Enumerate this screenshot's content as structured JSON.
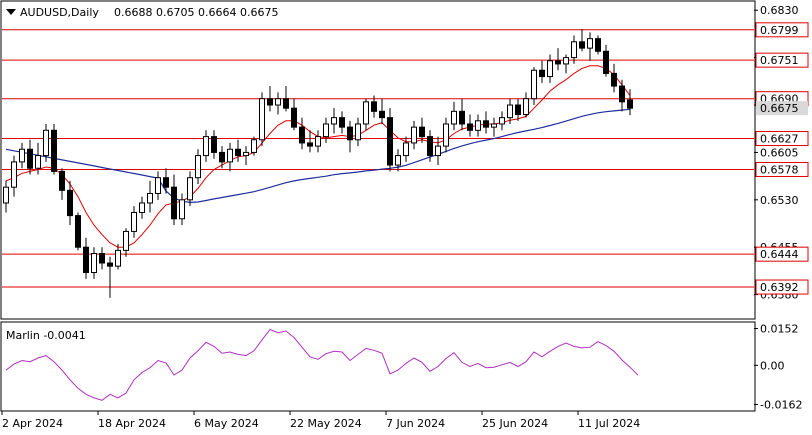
{
  "header": {
    "symbol": "AUDUSD,Daily",
    "ohlc": "0.6688 0.6705 0.6664 0.6675"
  },
  "indicator": {
    "label": "Marlin -0.0041"
  },
  "colors": {
    "background": "#ffffff",
    "level_line": "#e00000",
    "level_box": "#e00000",
    "ma_fast": "#e00000",
    "ma_slow": "#1f2fa0",
    "oscillator": "#b030c0",
    "candle_up": "#ffffff",
    "candle_down": "#000000",
    "price_tag": "#d9d9d9"
  },
  "chart_data": [
    {
      "type": "candlestick",
      "title": "AUDUSD,Daily",
      "ylim": [
        0.6343,
        0.6843
      ],
      "y_ticks": [
        "0.6830",
        "0.6755",
        "0.6680",
        "0.6605",
        "0.6530",
        "0.6455",
        "0.6380"
      ],
      "y_tick_values": [
        0.683,
        0.6755,
        0.668,
        0.6605,
        0.653,
        0.6455,
        0.638
      ],
      "x_labels": [
        "2 Apr 2024",
        "18 Apr 2024",
        "6 May 2024",
        "22 May 2024",
        "7 Jun 2024",
        "25 Jun 2024",
        "11 Jul 2024"
      ],
      "x_label_index": [
        0,
        12,
        24,
        36,
        48,
        60,
        72
      ],
      "last_price": "0.6675",
      "last_price_value": 0.6675,
      "horizontal_levels": [
        {
          "label": "0.6799",
          "value": 0.6799
        },
        {
          "label": "0.6751",
          "value": 0.6751
        },
        {
          "label": "0.6690",
          "value": 0.669
        },
        {
          "label": "0.6627",
          "value": 0.6627
        },
        {
          "label": "0.6578",
          "value": 0.6578
        },
        {
          "label": "0.6444",
          "value": 0.6444
        },
        {
          "label": "0.6392",
          "value": 0.6392
        }
      ],
      "candles": [
        [
          0.6525,
          0.656,
          0.651,
          0.655
        ],
        [
          0.655,
          0.66,
          0.6535,
          0.659
        ],
        [
          0.659,
          0.662,
          0.658,
          0.661
        ],
        [
          0.661,
          0.6625,
          0.657,
          0.658
        ],
        [
          0.658,
          0.662,
          0.657,
          0.66
        ],
        [
          0.66,
          0.665,
          0.659,
          0.664
        ],
        [
          0.664,
          0.665,
          0.657,
          0.6575
        ],
        [
          0.6575,
          0.658,
          0.653,
          0.6545
        ],
        [
          0.6545,
          0.656,
          0.649,
          0.6505
        ],
        [
          0.6505,
          0.651,
          0.645,
          0.6455
        ],
        [
          0.6455,
          0.647,
          0.6405,
          0.6415
        ],
        [
          0.6415,
          0.6455,
          0.6405,
          0.6445
        ],
        [
          0.6445,
          0.6455,
          0.642,
          0.643
        ],
        [
          0.643,
          0.644,
          0.6375,
          0.6425
        ],
        [
          0.6425,
          0.646,
          0.642,
          0.645
        ],
        [
          0.645,
          0.6485,
          0.644,
          0.648
        ],
        [
          0.648,
          0.652,
          0.647,
          0.651
        ],
        [
          0.651,
          0.6535,
          0.65,
          0.6525
        ],
        [
          0.6525,
          0.656,
          0.651,
          0.654
        ],
        [
          0.654,
          0.6575,
          0.653,
          0.6565
        ],
        [
          0.6565,
          0.658,
          0.654,
          0.655
        ],
        [
          0.655,
          0.657,
          0.649,
          0.65
        ],
        [
          0.65,
          0.654,
          0.649,
          0.653
        ],
        [
          0.653,
          0.6575,
          0.652,
          0.6565
        ],
        [
          0.6565,
          0.661,
          0.6555,
          0.66
        ],
        [
          0.66,
          0.664,
          0.659,
          0.663
        ],
        [
          0.663,
          0.664,
          0.6595,
          0.6605
        ],
        [
          0.6605,
          0.6615,
          0.658,
          0.659
        ],
        [
          0.659,
          0.662,
          0.6575,
          0.661
        ],
        [
          0.661,
          0.6625,
          0.659,
          0.66
        ],
        [
          0.66,
          0.6615,
          0.6585,
          0.6605
        ],
        [
          0.6605,
          0.663,
          0.66,
          0.6625
        ],
        [
          0.6625,
          0.67,
          0.6615,
          0.669
        ],
        [
          0.669,
          0.671,
          0.667,
          0.668
        ],
        [
          0.668,
          0.67,
          0.6665,
          0.669
        ],
        [
          0.669,
          0.671,
          0.667,
          0.6675
        ],
        [
          0.6675,
          0.669,
          0.664,
          0.6645
        ],
        [
          0.6645,
          0.666,
          0.661,
          0.662
        ],
        [
          0.662,
          0.664,
          0.6605,
          0.6615
        ],
        [
          0.6615,
          0.664,
          0.6605,
          0.663
        ],
        [
          0.663,
          0.666,
          0.662,
          0.665
        ],
        [
          0.665,
          0.6675,
          0.6635,
          0.666
        ],
        [
          0.666,
          0.667,
          0.6635,
          0.6645
        ],
        [
          0.6645,
          0.6655,
          0.6605,
          0.6625
        ],
        [
          0.6625,
          0.666,
          0.6615,
          0.665
        ],
        [
          0.665,
          0.669,
          0.664,
          0.6685
        ],
        [
          0.6685,
          0.6695,
          0.666,
          0.667
        ],
        [
          0.667,
          0.669,
          0.665,
          0.666
        ],
        [
          0.666,
          0.6675,
          0.6575,
          0.6585
        ],
        [
          0.6585,
          0.661,
          0.6575,
          0.66
        ],
        [
          0.66,
          0.663,
          0.659,
          0.662
        ],
        [
          0.662,
          0.6655,
          0.661,
          0.6645
        ],
        [
          0.6645,
          0.666,
          0.662,
          0.663
        ],
        [
          0.663,
          0.664,
          0.659,
          0.66
        ],
        [
          0.66,
          0.663,
          0.6585,
          0.6615
        ],
        [
          0.6615,
          0.666,
          0.6605,
          0.665
        ],
        [
          0.665,
          0.6685,
          0.664,
          0.667
        ],
        [
          0.667,
          0.669,
          0.664,
          0.665
        ],
        [
          0.665,
          0.6665,
          0.663,
          0.664
        ],
        [
          0.664,
          0.6665,
          0.663,
          0.6655
        ],
        [
          0.6655,
          0.667,
          0.6635,
          0.6645
        ],
        [
          0.6645,
          0.666,
          0.663,
          0.665
        ],
        [
          0.665,
          0.667,
          0.664,
          0.666
        ],
        [
          0.666,
          0.669,
          0.665,
          0.668
        ],
        [
          0.668,
          0.669,
          0.6655,
          0.6665
        ],
        [
          0.6665,
          0.67,
          0.666,
          0.669
        ],
        [
          0.669,
          0.674,
          0.668,
          0.6735
        ],
        [
          0.6735,
          0.675,
          0.6715,
          0.6725
        ],
        [
          0.6725,
          0.676,
          0.6715,
          0.675
        ],
        [
          0.675,
          0.677,
          0.6735,
          0.6745
        ],
        [
          0.6745,
          0.676,
          0.673,
          0.6755
        ],
        [
          0.6755,
          0.679,
          0.6745,
          0.678
        ],
        [
          0.678,
          0.68,
          0.6765,
          0.677
        ],
        [
          0.677,
          0.6795,
          0.675,
          0.6785
        ],
        [
          0.6785,
          0.679,
          0.676,
          0.6765
        ],
        [
          0.6765,
          0.6775,
          0.6725,
          0.673
        ],
        [
          0.673,
          0.6745,
          0.67,
          0.671
        ],
        [
          0.671,
          0.672,
          0.667,
          0.6685
        ],
        [
          0.6688,
          0.6705,
          0.6664,
          0.6675
        ]
      ],
      "ma_fast": [
        0.656,
        0.6565,
        0.6572,
        0.6575,
        0.6578,
        0.6582,
        0.658,
        0.657,
        0.6555,
        0.6535,
        0.651,
        0.649,
        0.6475,
        0.6462,
        0.6455,
        0.6455,
        0.6462,
        0.6475,
        0.649,
        0.6508,
        0.6522,
        0.6525,
        0.6528,
        0.6535,
        0.6548,
        0.6565,
        0.6578,
        0.6585,
        0.6592,
        0.6598,
        0.66,
        0.6605,
        0.662,
        0.6635,
        0.6648,
        0.6655,
        0.6655,
        0.6648,
        0.6638,
        0.663,
        0.6628,
        0.663,
        0.6632,
        0.663,
        0.6632,
        0.664,
        0.6648,
        0.6652,
        0.664,
        0.6628,
        0.6622,
        0.6622,
        0.6625,
        0.6622,
        0.662,
        0.6625,
        0.6635,
        0.6642,
        0.6645,
        0.6648,
        0.665,
        0.665,
        0.6652,
        0.6656,
        0.6658,
        0.6662,
        0.6675,
        0.6688,
        0.6702,
        0.6712,
        0.672,
        0.673,
        0.6738,
        0.6742,
        0.6742,
        0.6738,
        0.6728,
        0.6712,
        0.6695
      ]
    },
    {
      "type": "line",
      "name": "Marlin",
      "ylim": [
        -0.0185,
        0.0175
      ],
      "y_ticks": [
        "0.0152",
        "0.00",
        "-0.0162"
      ],
      "y_tick_values": [
        0.0152,
        0.0,
        -0.0162
      ],
      "values": [
        -0.002,
        0.0005,
        0.002,
        0.0015,
        0.003,
        0.004,
        0.0015,
        -0.002,
        -0.006,
        -0.0095,
        -0.012,
        -0.0135,
        -0.0145,
        -0.012,
        -0.0135,
        -0.0115,
        -0.006,
        -0.003,
        -0.001,
        0.002,
        0.001,
        -0.004,
        -0.002,
        0.003,
        0.006,
        0.0095,
        0.0078,
        0.005,
        0.0055,
        0.0045,
        0.004,
        0.006,
        0.0105,
        0.0148,
        0.0135,
        0.0142,
        0.0115,
        0.0075,
        0.0035,
        0.0025,
        0.0048,
        0.0058,
        0.0055,
        0.002,
        0.0045,
        0.007,
        0.0062,
        0.005,
        -0.0035,
        -0.002,
        0.0008,
        0.003,
        0.0012,
        -0.0025,
        -0.0005,
        0.0028,
        0.0052,
        0.0012,
        -0.0005,
        0.0008,
        -0.001,
        -0.0008,
        0.0002,
        0.0012,
        -0.0005,
        0.0015,
        0.0055,
        0.0035,
        0.0058,
        0.0078,
        0.0092,
        0.0078,
        0.0072,
        0.0075,
        0.0098,
        0.0082,
        0.0058,
        0.0022,
        -0.0008,
        -0.0041
      ]
    }
  ]
}
